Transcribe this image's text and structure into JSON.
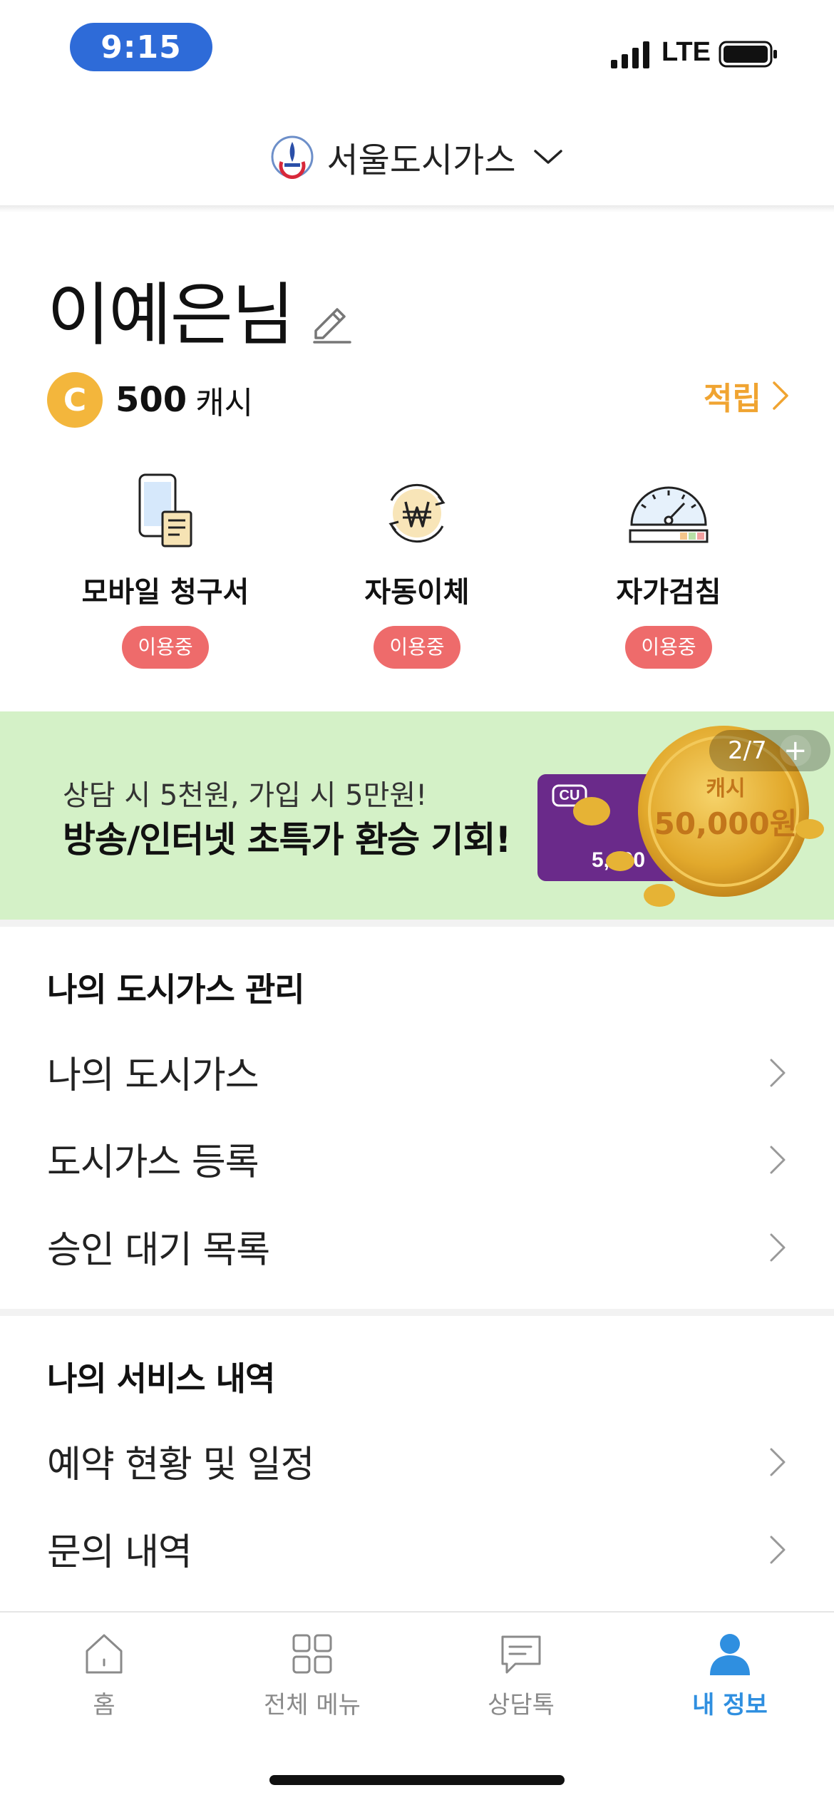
{
  "status_bar": {
    "time": "9:15",
    "network": "LTE",
    "icons": [
      "signal-icon",
      "battery-icon"
    ]
  },
  "header": {
    "brand": "서울도시가스",
    "logo_icon": "seoul-gas-logo",
    "dropdown_icon": "chevron-down-icon"
  },
  "profile": {
    "user_name": "이예은님",
    "edit_icon": "pencil-icon",
    "cash_symbol": "C",
    "cash_amount": "500",
    "cash_unit": "캐시",
    "earn_label": "적립"
  },
  "services": [
    {
      "label": "모바일 청구서",
      "status": "이용중",
      "icon": "mobile-bill-icon"
    },
    {
      "label": "자동이체",
      "status": "이용중",
      "icon": "auto-transfer-icon"
    },
    {
      "label": "자가검침",
      "status": "이용중",
      "icon": "meter-gauge-icon"
    }
  ],
  "banner": {
    "subtitle": "상담 시 5천원, 가입 시 5만원!",
    "title": "방송/인터넷 초특가 환승 기회!",
    "coin_label": "캐시",
    "coin_amount": "50,000원",
    "card_brand": "CU",
    "card_amount": "5,000",
    "counter": "2/7",
    "plus": "+",
    "colors": {
      "background": "#d4f1c7",
      "coin": "#e8b33a",
      "card": "#6a2a8a"
    }
  },
  "gas_section": {
    "title": "나의 도시가스 관리",
    "items": [
      {
        "label": "나의 도시가스"
      },
      {
        "label": "도시가스 등록"
      },
      {
        "label": "승인 대기 목록"
      }
    ]
  },
  "service_section": {
    "title": "나의 서비스 내역",
    "items": [
      {
        "label": "예약 현황 및 일정"
      },
      {
        "label": "문의 내역"
      }
    ]
  },
  "tab_bar": {
    "tabs": [
      {
        "label": "홈",
        "icon": "home-icon",
        "active": false
      },
      {
        "label": "전체 메뉴",
        "icon": "grid-menu-icon",
        "active": false
      },
      {
        "label": "상담톡",
        "icon": "chat-icon",
        "active": false
      },
      {
        "label": "내 정보",
        "icon": "person-icon",
        "active": true
      }
    ],
    "active_color": "#2f8fe0"
  },
  "colors": {
    "accent_orange": "#f0a431",
    "badge_red": "#ee6b6b",
    "time_pill": "#2e6bd8"
  }
}
